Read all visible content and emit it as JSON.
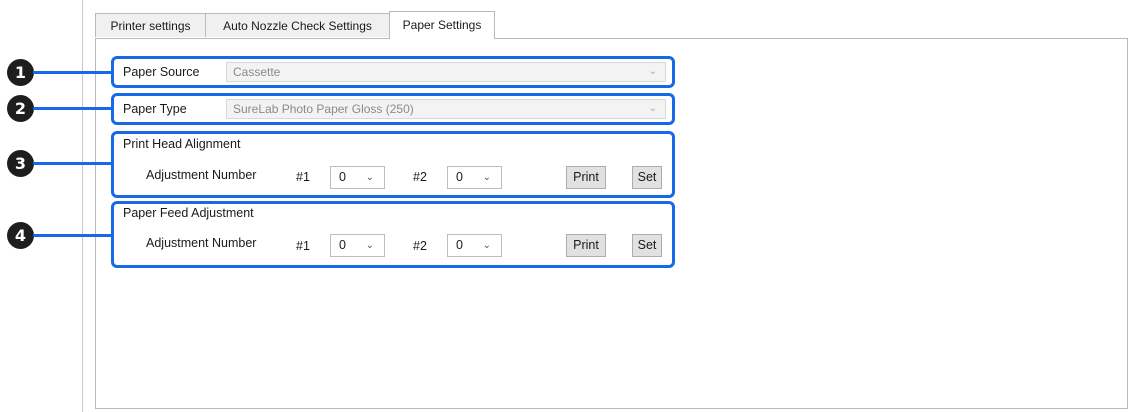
{
  "tabs": [
    {
      "label": "Printer settings"
    },
    {
      "label": "Auto Nozzle Check Settings"
    },
    {
      "label": "Paper Settings"
    }
  ],
  "active_tab": "Paper Settings",
  "paper_source": {
    "label": "Paper Source",
    "value": "Cassette",
    "disabled": true
  },
  "paper_type": {
    "label": "Paper Type",
    "value": "SureLab Photo Paper Gloss (250)",
    "disabled": true
  },
  "print_head_alignment": {
    "title": "Print Head Alignment",
    "adjustment_label": "Adjustment Number",
    "num1_label": "#1",
    "num1_value": "0",
    "num2_label": "#2",
    "num2_value": "0",
    "print_label": "Print",
    "set_label": "Set"
  },
  "paper_feed_adjustment": {
    "title": "Paper Feed Adjustment",
    "adjustment_label": "Adjustment Number",
    "num1_label": "#1",
    "num1_value": "0",
    "num2_label": "#2",
    "num2_value": "0",
    "print_label": "Print",
    "set_label": "Set"
  },
  "callouts": [
    "1",
    "2",
    "3",
    "4"
  ],
  "colors": {
    "callout": "#1769e8",
    "badge": "#1e1e1e"
  },
  "icons": {
    "dropdown": "chevron-down-icon"
  }
}
